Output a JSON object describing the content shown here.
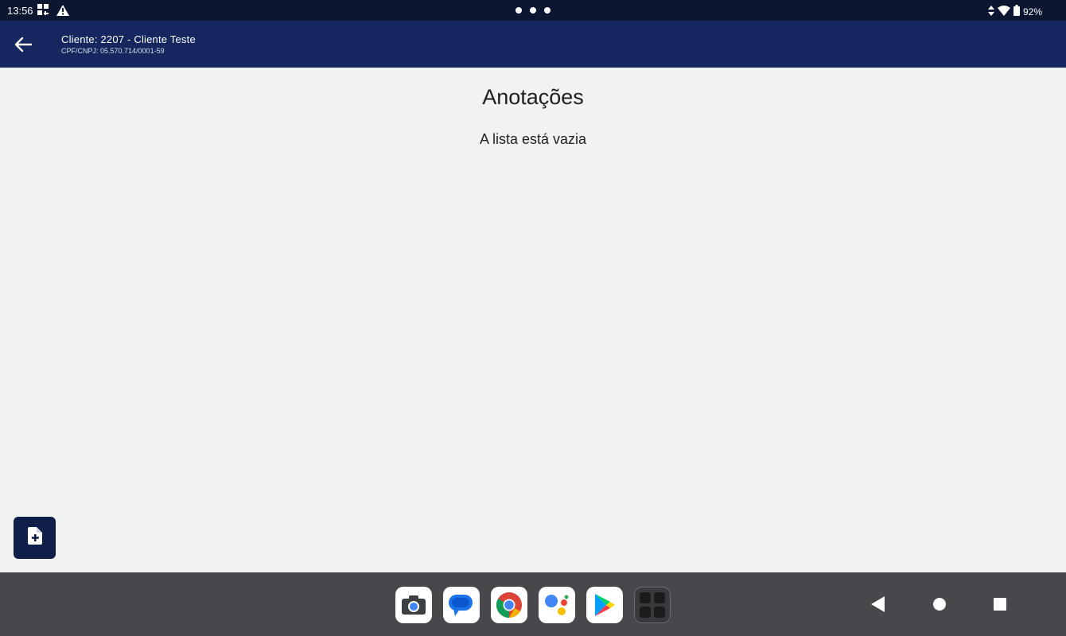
{
  "status": {
    "time": "13:56",
    "battery": "92%",
    "icons": [
      "qr-code-icon",
      "warning-icon",
      "data-arrows-icon",
      "wifi-icon",
      "battery-icon"
    ]
  },
  "appbar": {
    "title": "Cliente: 2207 - Cliente Teste",
    "subtitle": "CPF/CNPJ: 05.570.714/0001-59"
  },
  "main": {
    "heading": "Anotações",
    "empty_message": "A lista está vazia"
  },
  "fab": {
    "icon": "add-note-icon"
  },
  "dock": {
    "apps": [
      "camera",
      "messages",
      "chrome",
      "assistant",
      "play-store",
      "app-drawer"
    ]
  },
  "colors": {
    "statusbar": "#0c1631",
    "appbar": "#15275e",
    "fab": "#0f1f4a",
    "background": "#f1f2f2",
    "navbar": "#48484c"
  }
}
